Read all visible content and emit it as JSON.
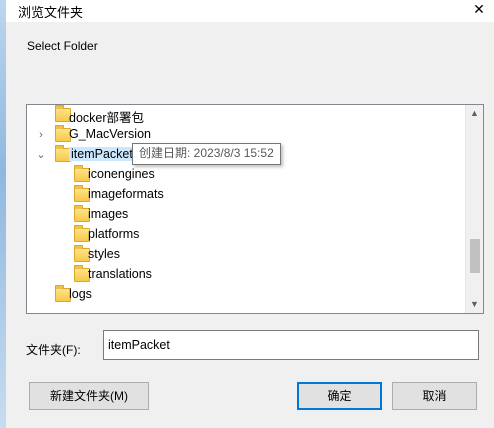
{
  "window": {
    "title": "浏览文件夹",
    "close_glyph": "✕"
  },
  "instruction": "Select Folder",
  "tree": {
    "items": [
      {
        "label": "docker部署包",
        "expander": "",
        "level": 0,
        "selected": false
      },
      {
        "label": "G_MacVersion",
        "expander": "›",
        "level": 0,
        "selected": false
      },
      {
        "label": "itemPacket",
        "expander": "⌄",
        "level": 0,
        "selected": true
      },
      {
        "label": "iconengines",
        "expander": "",
        "level": 1,
        "selected": false
      },
      {
        "label": "imageformats",
        "expander": "",
        "level": 1,
        "selected": false
      },
      {
        "label": "images",
        "expander": "",
        "level": 1,
        "selected": false
      },
      {
        "label": "platforms",
        "expander": "",
        "level": 1,
        "selected": false
      },
      {
        "label": "styles",
        "expander": "",
        "level": 1,
        "selected": false
      },
      {
        "label": "translations",
        "expander": "",
        "level": 1,
        "selected": false
      },
      {
        "label": "logs",
        "expander": "",
        "level": 0,
        "selected": false
      }
    ],
    "scroll_up": "▲",
    "scroll_down": "▼"
  },
  "tooltip": "创建日期: 2023/8/3 15:52",
  "folder_field": {
    "label": "文件夹(F):",
    "value": "itemPacket"
  },
  "buttons": {
    "new_folder": "新建文件夹(M)",
    "ok": "确定",
    "cancel": "取消"
  },
  "colors": {
    "selection": "#cce8ff",
    "accent": "#0078d7",
    "folder": "#f7c948"
  },
  "icons": {
    "folder": "folder-icon",
    "expander_closed": "chevron-right-icon",
    "expander_open": "chevron-down-icon"
  }
}
